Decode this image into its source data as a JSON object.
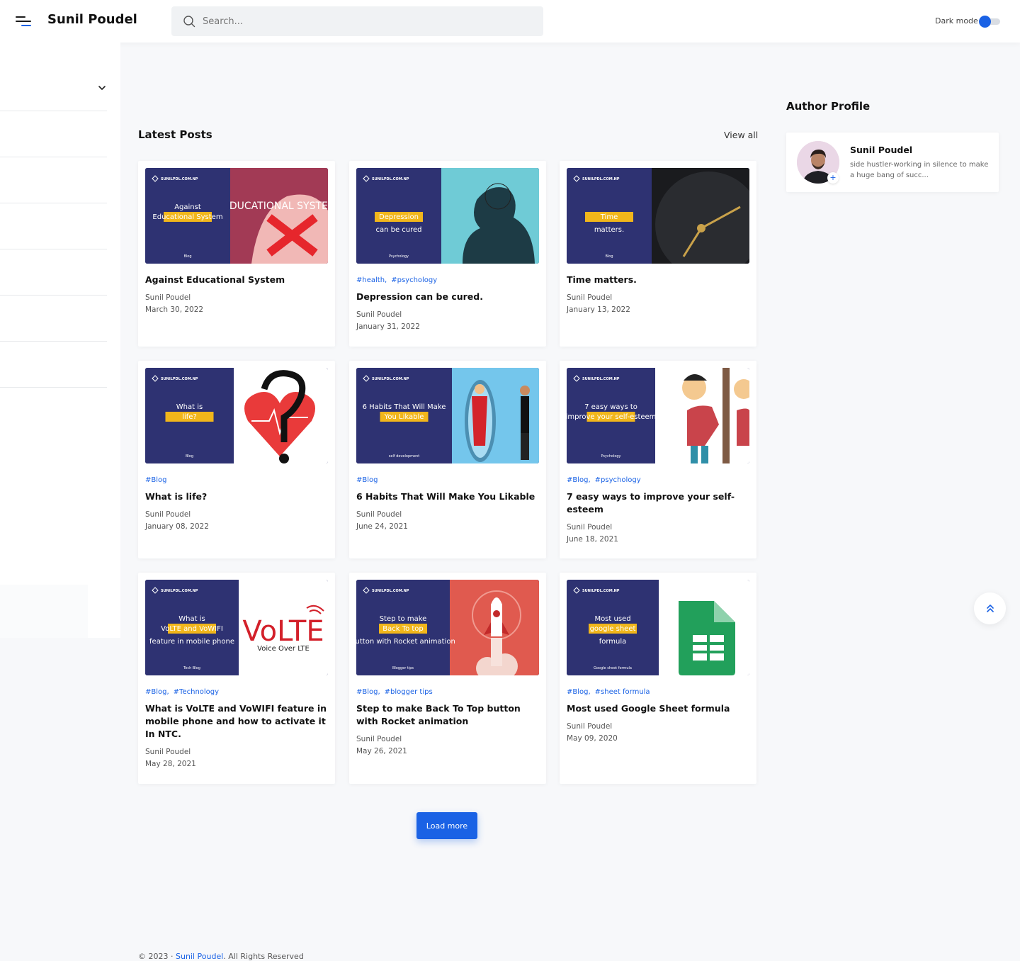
{
  "header": {
    "site_title": "Sunil Poudel",
    "search_placeholder": "Search...",
    "dark_mode_label": "Dark mode",
    "dark_mode_on": true,
    "accent_color": "#1a62e5"
  },
  "main": {
    "section_title": "Latest Posts",
    "view_all_label": "View all",
    "load_more_label": "Load more",
    "posts": [
      {
        "title": "Against Educational System",
        "tags": [],
        "author": "Sunil Poudel",
        "date": "March 30, 2022",
        "thumb": {
          "brand": "SUNILPDL.COM.NP",
          "line1": "Against",
          "highlight": "Educational System",
          "line2": "",
          "footer": "Blog",
          "art": "EDUCATIONAL SYSTEM"
        }
      },
      {
        "title": "Depression can be cured.",
        "tags": [
          "#health,",
          "#psychology"
        ],
        "author": "Sunil Poudel",
        "date": "January 31, 2022",
        "thumb": {
          "brand": "SUNILPDL.COM.NP",
          "line1": "",
          "highlight": "Depression",
          "line2": "can be cured",
          "footer": "Psychology",
          "art": ""
        }
      },
      {
        "title": "Time matters.",
        "tags": [],
        "author": "Sunil Poudel",
        "date": "January 13, 2022",
        "thumb": {
          "brand": "SUNILPDL.COM.NP",
          "line1": "",
          "highlight": "Time",
          "line2": "matters.",
          "footer": "Blog",
          "art": ""
        }
      },
      {
        "title": "What is life?",
        "tags": [
          "#Blog"
        ],
        "author": "Sunil Poudel",
        "date": "January 08, 2022",
        "thumb": {
          "brand": "SUNILPDL.COM.NP",
          "line1": "What is",
          "highlight": "life?",
          "line2": "",
          "footer": "Blog",
          "art": ""
        }
      },
      {
        "title": "6 Habits That Will Make You Likable",
        "tags": [
          "#Blog"
        ],
        "author": "Sunil Poudel",
        "date": "June 24, 2021",
        "thumb": {
          "brand": "SUNILPDL.COM.NP",
          "line1": "6 Habits That Will Make",
          "highlight": "You Likable",
          "line2": "",
          "footer": "self development",
          "art": ""
        }
      },
      {
        "title": "7 easy ways to improve your self-esteem",
        "tags": [
          "#Blog,",
          "#psychology"
        ],
        "author": "Sunil Poudel",
        "date": "June 18, 2021",
        "thumb": {
          "brand": "SUNILPDL.COM.NP",
          "line1": "7 easy ways to",
          "highlight": "improve your self-esteem",
          "line2": "",
          "footer": "Psychology",
          "art": ""
        }
      },
      {
        "title": "What is VoLTE and VoWIFI feature in mobile phone and how to activate it In NTC.",
        "tags": [
          "#Blog,",
          "#Technology"
        ],
        "author": "Sunil Poudel",
        "date": "May 28, 2021",
        "thumb": {
          "brand": "SUNILPDL.COM.NP",
          "line1": "What is",
          "highlight": "VoLTE and VoWIFI",
          "line2": "feature in mobile phone",
          "footer": "Tech Blog",
          "art": "VoLTE",
          "art_sub": "Voice Over LTE"
        }
      },
      {
        "title": "Step to make Back To Top button with Rocket animation",
        "tags": [
          "#Blog,",
          "#blogger tips"
        ],
        "author": "Sunil Poudel",
        "date": "May 26, 2021",
        "thumb": {
          "brand": "SUNILPDL.COM.NP",
          "line1": "Step to make",
          "highlight": "Back To top",
          "line2": "button with Rocket animation",
          "footer": "Blogger tips",
          "art": ""
        }
      },
      {
        "title": "Most used Google Sheet formula",
        "tags": [
          "#Blog,",
          "#sheet formula"
        ],
        "author": "Sunil Poudel",
        "date": "May 09, 2020",
        "thumb": {
          "brand": "SUNILPDL.COM.NP",
          "line1": "Most used",
          "highlight": "google sheet",
          "line2": "formula",
          "footer": "Google sheet formula",
          "art": ""
        }
      }
    ]
  },
  "author_profile": {
    "title": "Author Profile",
    "name": "Sunil Poudel",
    "bio": "side hustler-working in silence to make a huge bang of succ..."
  },
  "footer": {
    "prefix": "© 2023 · ",
    "link": "Sunil Poudel",
    "suffix": ". All Rights Reserved"
  },
  "icons": {
    "menu": "menu-icon",
    "search": "search-icon",
    "chevron": "chevron-down-icon",
    "back_to_top": "double-chevron-up-icon"
  }
}
